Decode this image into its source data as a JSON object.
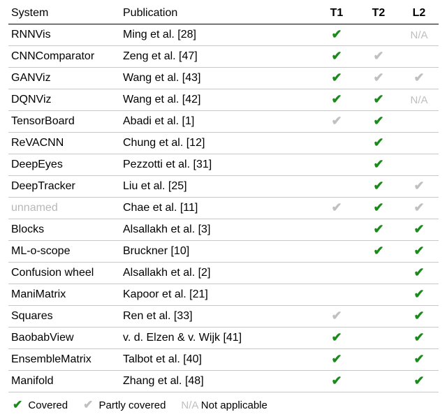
{
  "headers": {
    "system": "System",
    "publication": "Publication",
    "t1": "T1",
    "t2": "T2",
    "l2": "L2"
  },
  "symbols": {
    "covered": "✔",
    "partly": "✔",
    "na": "N/A"
  },
  "rows": [
    {
      "system": "RNNVis",
      "publication": "Ming et al. [28]",
      "t1": "covered",
      "t2": "",
      "l2": "na"
    },
    {
      "system": "CNNComparator",
      "publication": "Zeng et al. [47]",
      "t1": "covered",
      "t2": "partly",
      "l2": ""
    },
    {
      "system": "GANViz",
      "publication": "Wang et al. [43]",
      "t1": "covered",
      "t2": "partly",
      "l2": "partly"
    },
    {
      "system": "DQNViz",
      "publication": "Wang et al. [42]",
      "t1": "covered",
      "t2": "covered",
      "l2": "na"
    },
    {
      "system": "TensorBoard",
      "publication": "Abadi et al. [1]",
      "t1": "partly",
      "t2": "covered",
      "l2": ""
    },
    {
      "system": "ReVACNN",
      "publication": "Chung et al. [12]",
      "t1": "",
      "t2": "covered",
      "l2": ""
    },
    {
      "system": "DeepEyes",
      "publication": "Pezzotti et al. [31]",
      "t1": "",
      "t2": "covered",
      "l2": ""
    },
    {
      "system": "DeepTracker",
      "publication": "Liu et al. [25]",
      "t1": "",
      "t2": "covered",
      "l2": "partly"
    },
    {
      "system": "unnamed",
      "sys_grey": true,
      "publication": "Chae et al. [11]",
      "t1": "partly",
      "t2": "covered",
      "l2": "partly"
    },
    {
      "system": "Blocks",
      "publication": "Alsallakh et al. [3]",
      "t1": "",
      "t2": "covered",
      "l2": "covered"
    },
    {
      "system": "ML-o-scope",
      "publication": "Bruckner [10]",
      "t1": "",
      "t2": "covered",
      "l2": "covered"
    },
    {
      "system": "Confusion wheel",
      "publication": "Alsallakh et al. [2]",
      "t1": "",
      "t2": "",
      "l2": "covered"
    },
    {
      "system": "ManiMatrix",
      "publication": "Kapoor et al. [21]",
      "t1": "",
      "t2": "",
      "l2": "covered"
    },
    {
      "system": "Squares",
      "publication": "Ren et al. [33]",
      "t1": "partly",
      "t2": "",
      "l2": "covered"
    },
    {
      "system": "BaobabView",
      "publication": "v. d. Elzen & v. Wijk [41]",
      "t1": "covered",
      "t2": "",
      "l2": "covered"
    },
    {
      "system": "EnsembleMatrix",
      "publication": "Talbot et al. [40]",
      "t1": "covered",
      "t2": "",
      "l2": "covered"
    },
    {
      "system": "Manifold",
      "publication": "Zhang et al. [48]",
      "t1": "covered",
      "t2": "",
      "l2": "covered"
    }
  ],
  "legend": {
    "covered": "Covered",
    "partly": "Partly covered",
    "na": "Not applicable"
  }
}
